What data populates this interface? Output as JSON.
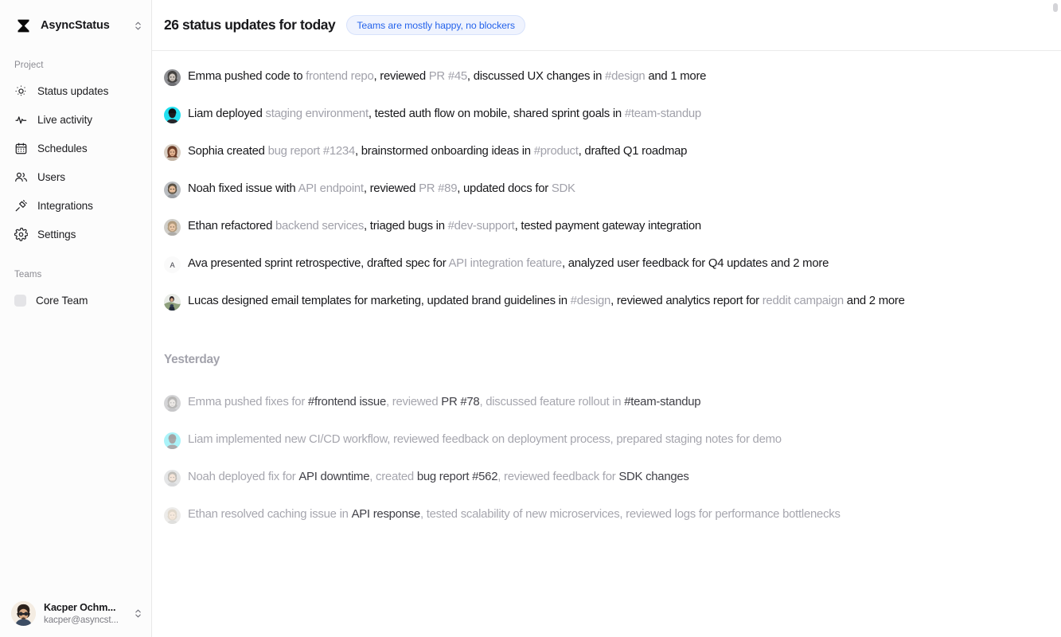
{
  "sidebar": {
    "brand": {
      "name": "AsyncStatus",
      "logo_icon": "hourglass-icon",
      "switcher_icon": "chevron-up-down-icon"
    },
    "project_label": "Project",
    "items": [
      {
        "label": "Status updates",
        "icon": "sun-radar-icon"
      },
      {
        "label": "Live activity",
        "icon": "activity-pulse-icon"
      },
      {
        "label": "Schedules",
        "icon": "calendar-icon"
      },
      {
        "label": "Users",
        "icon": "users-icon"
      },
      {
        "label": "Integrations",
        "icon": "plug-icon"
      },
      {
        "label": "Settings",
        "icon": "gear-icon"
      }
    ],
    "teams_label": "Teams",
    "teams": [
      {
        "label": "Core Team",
        "swatch": "#e4e4e7"
      }
    ],
    "footer": {
      "name": "Kacper Ochm...",
      "email": "kacper@asyncst...",
      "avatar_icon": "user-avatar",
      "switcher_icon": "chevron-up-down-icon"
    }
  },
  "header": {
    "title": "26 status updates for today",
    "badge": "Teams are mostly happy, no blockers",
    "badge_color": "#2563eb",
    "badge_bg": "#eff3fe"
  },
  "today": {
    "updates": [
      {
        "avatar": "emma",
        "parts": [
          {
            "t": "Emma pushed code to ",
            "ent": false
          },
          {
            "t": "frontend repo",
            "ent": true
          },
          {
            "t": ", reviewed ",
            "ent": false
          },
          {
            "t": "PR #45",
            "ent": true
          },
          {
            "t": ", discussed UX changes in ",
            "ent": false
          },
          {
            "t": "#design",
            "ent": true
          },
          {
            "t": " and 1 more",
            "ent": false
          }
        ]
      },
      {
        "avatar": "liam",
        "parts": [
          {
            "t": "Liam deployed ",
            "ent": false
          },
          {
            "t": "staging environment",
            "ent": true
          },
          {
            "t": ", tested auth flow on mobile, shared sprint goals in ",
            "ent": false
          },
          {
            "t": "#team-standup",
            "ent": true
          }
        ]
      },
      {
        "avatar": "sophia",
        "parts": [
          {
            "t": "Sophia created ",
            "ent": false
          },
          {
            "t": "bug report #1234",
            "ent": true
          },
          {
            "t": ", brainstormed onboarding ideas in ",
            "ent": false
          },
          {
            "t": "#product",
            "ent": true
          },
          {
            "t": ", drafted Q1 roadmap",
            "ent": false
          }
        ]
      },
      {
        "avatar": "noah",
        "parts": [
          {
            "t": "Noah fixed issue with ",
            "ent": false
          },
          {
            "t": "API endpoint",
            "ent": true
          },
          {
            "t": ", reviewed ",
            "ent": false
          },
          {
            "t": "PR #89",
            "ent": true
          },
          {
            "t": ", updated docs for ",
            "ent": false
          },
          {
            "t": "SDK",
            "ent": true
          }
        ]
      },
      {
        "avatar": "ethan",
        "parts": [
          {
            "t": "Ethan refactored ",
            "ent": false
          },
          {
            "t": "backend services",
            "ent": true
          },
          {
            "t": ", triaged bugs in ",
            "ent": false
          },
          {
            "t": "#dev-support",
            "ent": true
          },
          {
            "t": ", tested payment gateway integration",
            "ent": false
          }
        ]
      },
      {
        "avatar": "ava",
        "parts": [
          {
            "t": "Ava presented sprint retrospective, drafted spec for ",
            "ent": false
          },
          {
            "t": "API integration feature",
            "ent": true
          },
          {
            "t": ", analyzed user feedback for Q4 updates and 2 more",
            "ent": false
          }
        ]
      },
      {
        "avatar": "lucas",
        "parts": [
          {
            "t": "Lucas designed email templates for marketing, updated brand guidelines in ",
            "ent": false
          },
          {
            "t": "#design",
            "ent": true
          },
          {
            "t": ", reviewed analytics report for ",
            "ent": false
          },
          {
            "t": "reddit campaign",
            "ent": true
          },
          {
            "t": " and 2 more",
            "ent": false
          }
        ]
      }
    ]
  },
  "yesterday": {
    "heading": "Yesterday",
    "updates": [
      {
        "avatar": "emma",
        "parts": [
          {
            "t": "Emma pushed fixes for ",
            "ent": false
          },
          {
            "t": "#frontend issue",
            "ent": true
          },
          {
            "t": ", reviewed ",
            "ent": false
          },
          {
            "t": "PR #78",
            "ent": true
          },
          {
            "t": ", discussed feature rollout in ",
            "ent": false
          },
          {
            "t": "#team-standup",
            "ent": true
          }
        ]
      },
      {
        "avatar": "liam",
        "parts": [
          {
            "t": "Liam implemented new CI/CD workflow, reviewed feedback on deployment process, prepared staging notes for demo",
            "ent": false
          }
        ]
      },
      {
        "avatar": "noah",
        "parts": [
          {
            "t": "Noah deployed fix for ",
            "ent": false
          },
          {
            "t": "API downtime",
            "ent": true
          },
          {
            "t": ", created ",
            "ent": false
          },
          {
            "t": "bug report #562",
            "ent": true
          },
          {
            "t": ", reviewed feedback for ",
            "ent": false
          },
          {
            "t": "SDK changes",
            "ent": true
          }
        ]
      },
      {
        "avatar": "ethan",
        "parts": [
          {
            "t": "Ethan resolved caching issue in ",
            "ent": false
          },
          {
            "t": "API response",
            "ent": true
          },
          {
            "t": ", tested scalability of new microservices, reviewed logs for performance bottlenecks",
            "ent": false
          }
        ]
      }
    ]
  }
}
